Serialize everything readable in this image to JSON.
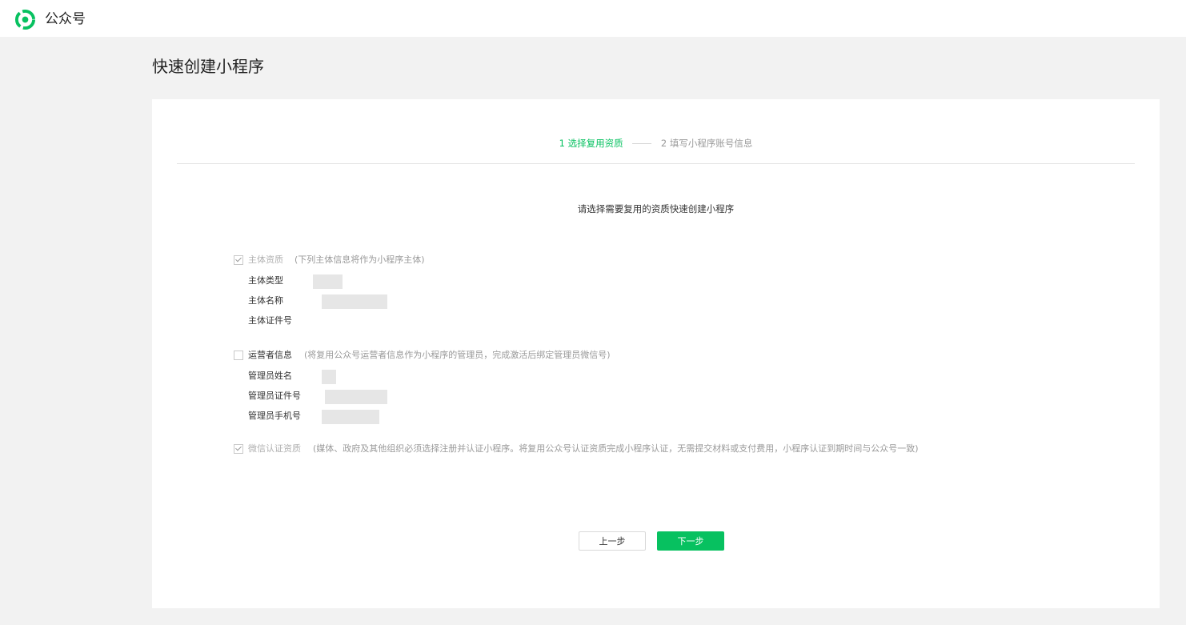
{
  "brand": {
    "name": "公众号",
    "logo_icon": "wechat-official-account-logo-icon",
    "accent_color": "#07c160"
  },
  "page": {
    "title": "快速创建小程序"
  },
  "steps": [
    {
      "label": "1 选择复用资质",
      "state": "active"
    },
    {
      "label": "2 填写小程序账号信息",
      "state": "inactive"
    }
  ],
  "intro": "请选择需要复用的资质快速创建小程序",
  "sections": {
    "subject": {
      "label": "主体资质",
      "note": "(下列主体信息将作为小程序主体)",
      "checked": true,
      "disabled": true,
      "fields": [
        {
          "label": "主体类型",
          "value": ""
        },
        {
          "label": "主体名称",
          "value": ""
        },
        {
          "label": "主体证件号",
          "value": ""
        }
      ]
    },
    "operator": {
      "label": "运营者信息",
      "note": "(将复用公众号运营者信息作为小程序的管理员，完成激活后绑定管理员微信号)",
      "checked": false,
      "disabled": false,
      "fields": [
        {
          "label": "管理员姓名",
          "value": ""
        },
        {
          "label": "管理员证件号",
          "value": ""
        },
        {
          "label": "管理员手机号",
          "value": ""
        }
      ]
    },
    "verification": {
      "label": "微信认证资质",
      "note": "(媒体、政府及其他组织必须选择注册并认证小程序。将复用公众号认证资质完成小程序认证，无需提交材料或支付费用，小程序认证到期时间与公众号一致)",
      "checked": true,
      "disabled": true
    }
  },
  "buttons": {
    "prev": "上一步",
    "next": "下一步"
  }
}
